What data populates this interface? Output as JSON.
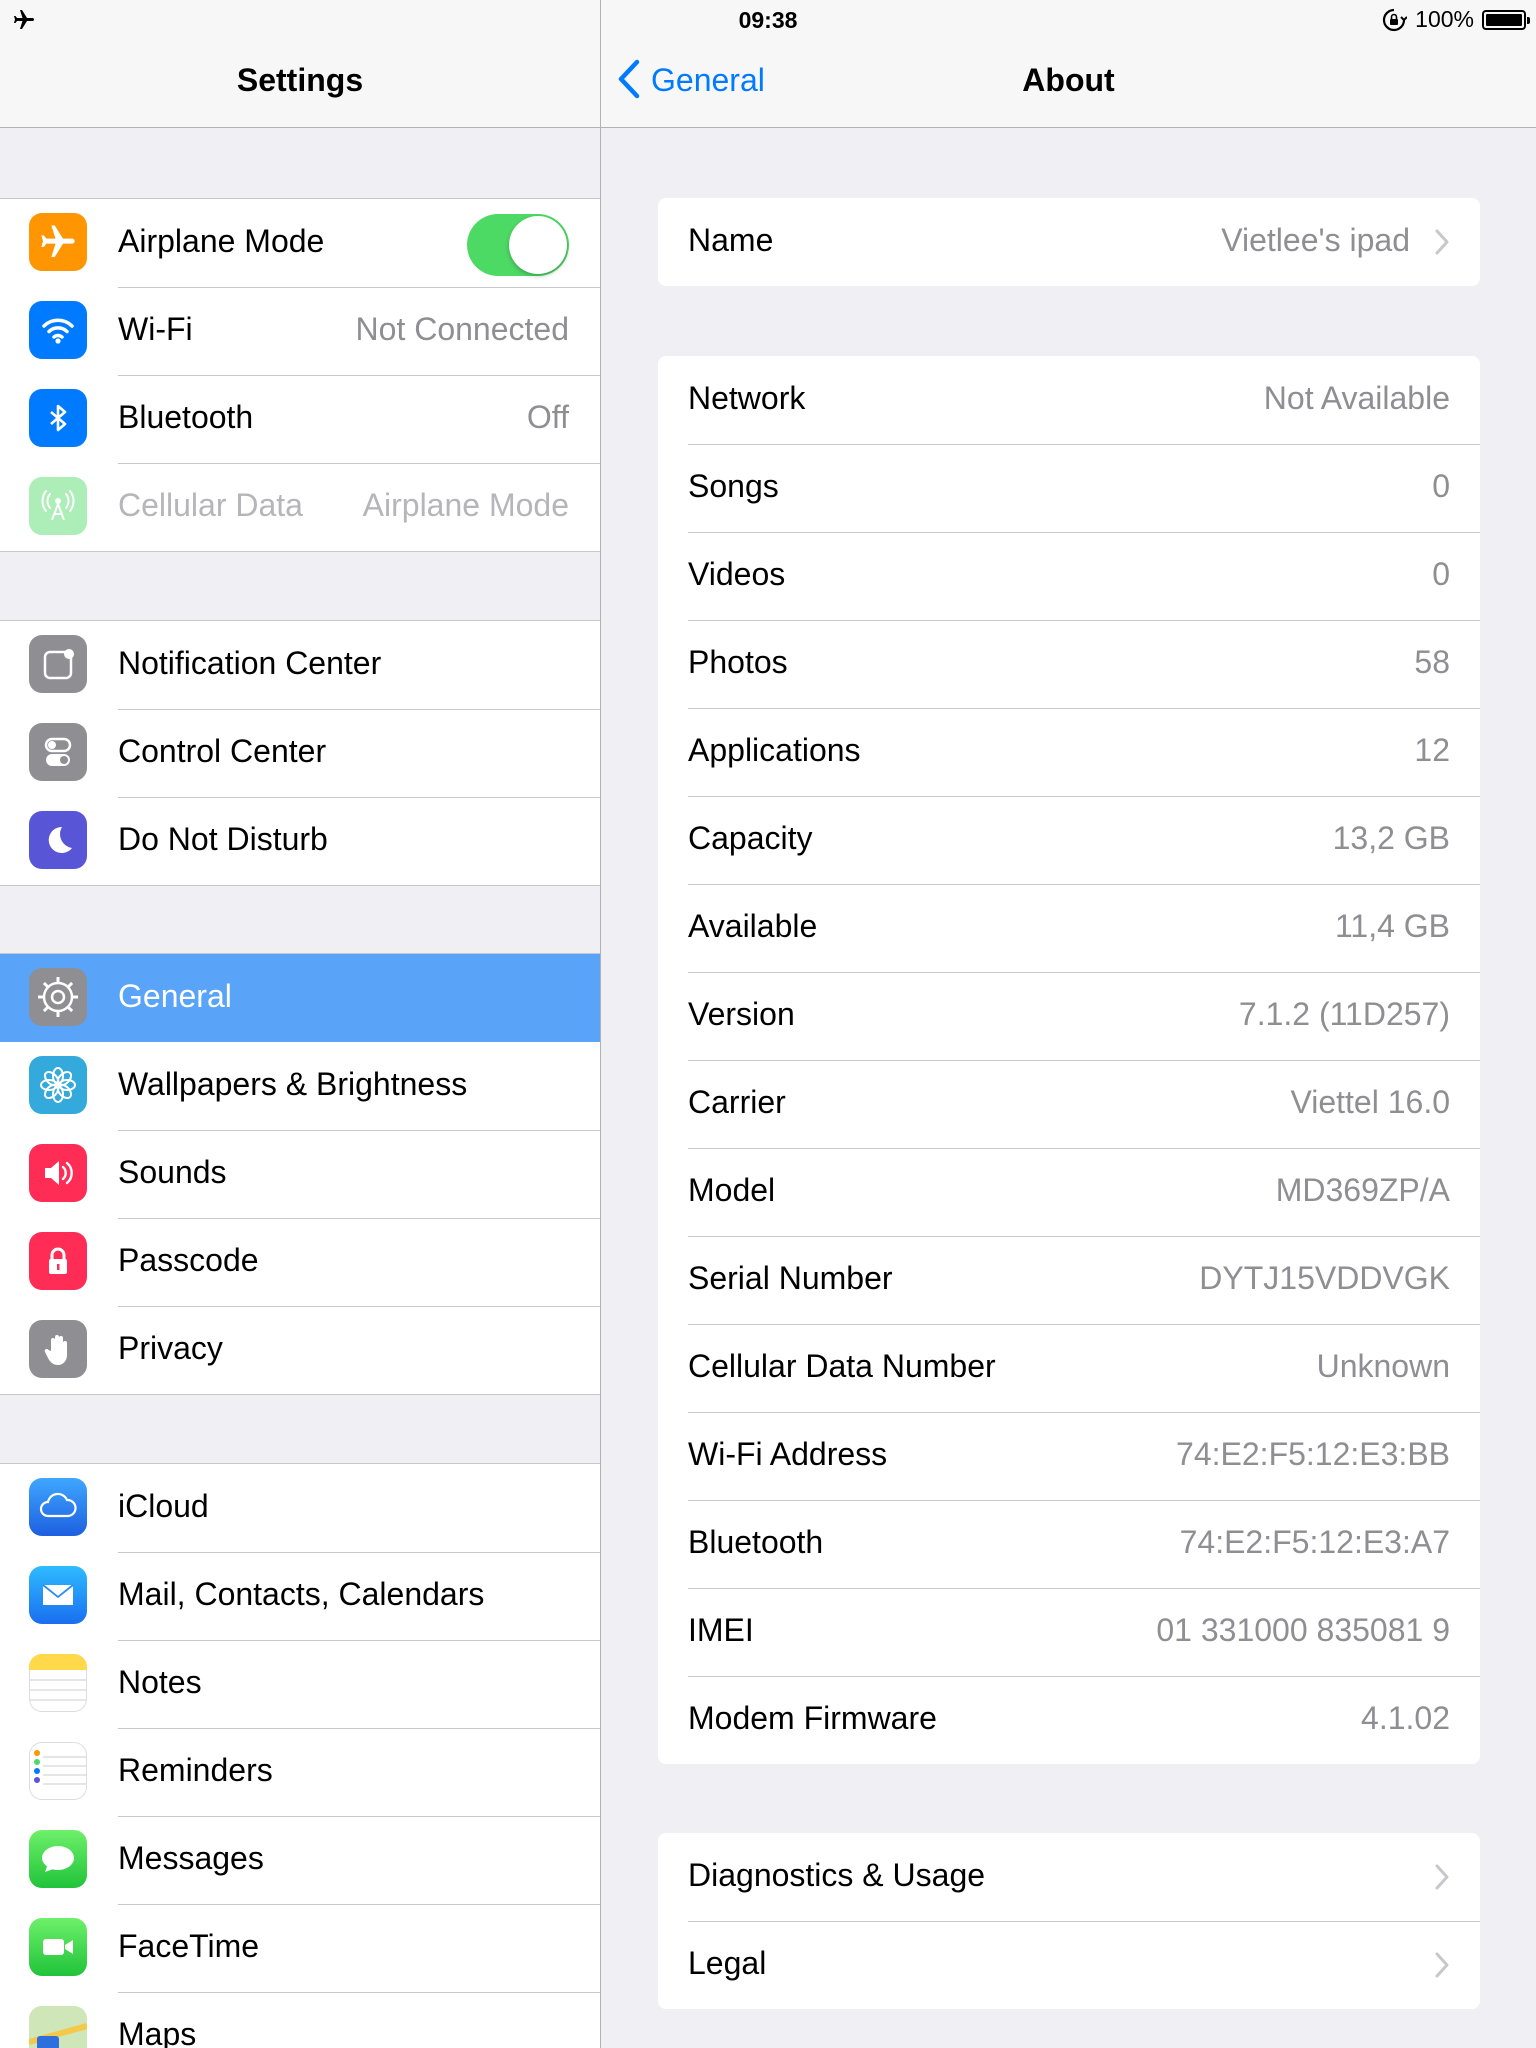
{
  "status_bar": {
    "time": "09:38",
    "battery_text": "100%",
    "icons": [
      "airplane-icon",
      "rotation-lock-icon",
      "battery-icon"
    ]
  },
  "master": {
    "title": "Settings",
    "groups": [
      [
        {
          "label": "Airplane Mode",
          "icon": "airplane-icon",
          "color": "#ff9500",
          "toggle": true
        },
        {
          "label": "Wi-Fi",
          "value": "Not Connected",
          "icon": "wifi-icon",
          "color": "#007aff"
        },
        {
          "label": "Bluetooth",
          "value": "Off",
          "icon": "bluetooth-icon",
          "color": "#007aff"
        },
        {
          "label": "Cellular Data",
          "value": "Airplane Mode",
          "icon": "cellular-icon",
          "color": "#4cd964",
          "disabled": true
        }
      ],
      [
        {
          "label": "Notification Center",
          "icon": "notification-center-icon",
          "color": "#8e8e93"
        },
        {
          "label": "Control Center",
          "icon": "control-center-icon",
          "color": "#8e8e93"
        },
        {
          "label": "Do Not Disturb",
          "icon": "moon-icon",
          "color": "#5856d6"
        }
      ],
      [
        {
          "label": "General",
          "icon": "gear-icon",
          "color": "#8e8e93",
          "selected": true
        },
        {
          "label": "Wallpapers & Brightness",
          "icon": "flower-icon",
          "color": "#34aadc"
        },
        {
          "label": "Sounds",
          "icon": "speaker-icon",
          "color": "#ff2d55"
        },
        {
          "label": "Passcode",
          "icon": "lock-icon",
          "color": "#ff2d55"
        },
        {
          "label": "Privacy",
          "icon": "hand-icon",
          "color": "#8e8e93"
        }
      ],
      [
        {
          "label": "iCloud",
          "icon": "cloud-icon",
          "color": "#1d77ef"
        },
        {
          "label": "Mail, Contacts, Calendars",
          "icon": "envelope-icon",
          "color": "#1d77ef"
        },
        {
          "label": "Notes",
          "icon": "notes-icon",
          "color": "#ffffff"
        },
        {
          "label": "Reminders",
          "icon": "reminders-icon",
          "color": "#ffffff"
        },
        {
          "label": "Messages",
          "icon": "messages-icon",
          "color": "#4cd964"
        },
        {
          "label": "FaceTime",
          "icon": "video-camera-icon",
          "color": "#4cd964"
        },
        {
          "label": "Maps",
          "icon": "maps-icon",
          "color": "#ffffff"
        }
      ]
    ]
  },
  "detail": {
    "back_label": "General",
    "title": "About",
    "groups": [
      [
        {
          "label": "Name",
          "value": "Vietlee's ipad",
          "chevron": true
        }
      ],
      [
        {
          "label": "Network",
          "value": "Not Available"
        },
        {
          "label": "Songs",
          "value": "0"
        },
        {
          "label": "Videos",
          "value": "0"
        },
        {
          "label": "Photos",
          "value": "58"
        },
        {
          "label": "Applications",
          "value": "12"
        },
        {
          "label": "Capacity",
          "value": "13,2 GB"
        },
        {
          "label": "Available",
          "value": "11,4 GB"
        },
        {
          "label": "Version",
          "value": "7.1.2 (11D257)"
        },
        {
          "label": "Carrier",
          "value": "Viettel 16.0"
        },
        {
          "label": "Model",
          "value": "MD369ZP/A"
        },
        {
          "label": "Serial Number",
          "value": "DYTJ15VDDVGK"
        },
        {
          "label": "Cellular Data Number",
          "value": "Unknown"
        },
        {
          "label": "Wi-Fi Address",
          "value": "74:E2:F5:12:E3:BB"
        },
        {
          "label": "Bluetooth",
          "value": "74:E2:F5:12:E3:A7"
        },
        {
          "label": "IMEI",
          "value": "01 331000 835081 9"
        },
        {
          "label": "Modem Firmware",
          "value": "4.1.02"
        }
      ],
      [
        {
          "label": "Diagnostics & Usage",
          "chevron": true
        },
        {
          "label": "Legal",
          "chevron": true
        }
      ]
    ]
  },
  "colors": {
    "accent": "#007aff",
    "selected_row": "#59a3f9",
    "toggle_on": "#4cd964",
    "secondary_text": "#8e8e93",
    "background": "#efeff4"
  }
}
